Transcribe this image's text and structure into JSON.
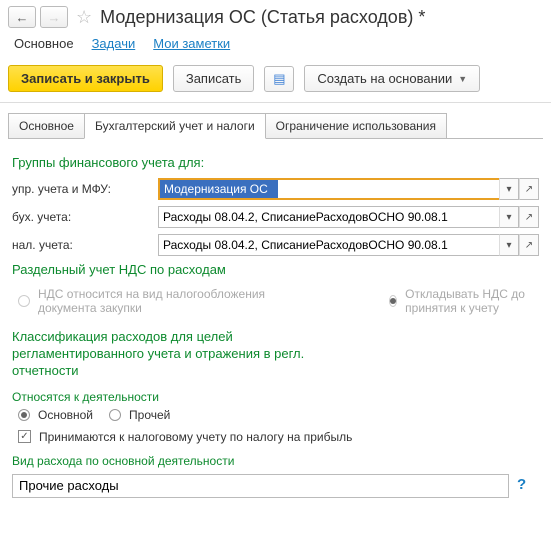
{
  "title": "Модернизация ОС (Статья расходов) *",
  "nav": {
    "main": "Основное",
    "tasks": "Задачи",
    "notes": "Мои заметки"
  },
  "toolbar": {
    "save_close": "Записать и закрыть",
    "save": "Записать",
    "create_based": "Создать на основании"
  },
  "tabs": {
    "main": "Основное",
    "acct": "Бухгалтерский учет и налоги",
    "restrict": "Ограничение использования"
  },
  "section_groups": "Группы финансового учета для:",
  "rows": {
    "upr_label": "упр. учета и МФУ:",
    "upr_value": "Модернизация ОС",
    "buh_label": "бух. учета:",
    "buh_value": "Расходы 08.04.2, СписаниеРасходовОСНО 90.08.1",
    "nal_label": "нал. учета:",
    "nal_value": "Расходы 08.04.2, СписаниеРасходовОСНО 90.08.1"
  },
  "nds_title": "Раздельный учет НДС по расходам",
  "nds_opt1": "НДС относится на вид налогообложения документа закупки",
  "nds_opt2": "Откладывать НДС до принятия к учету",
  "class_title": "Классификация расходов для целей регламентированного учета и отражения в регл. отчетности",
  "activity_label": "Относятся к деятельности",
  "activity_main": "Основной",
  "activity_other": "Прочей",
  "tax_check": "Принимаются к налоговому учету по налогу на прибыль",
  "kind_label": "Вид расхода по основной деятельности",
  "kind_value": "Прочие расходы"
}
